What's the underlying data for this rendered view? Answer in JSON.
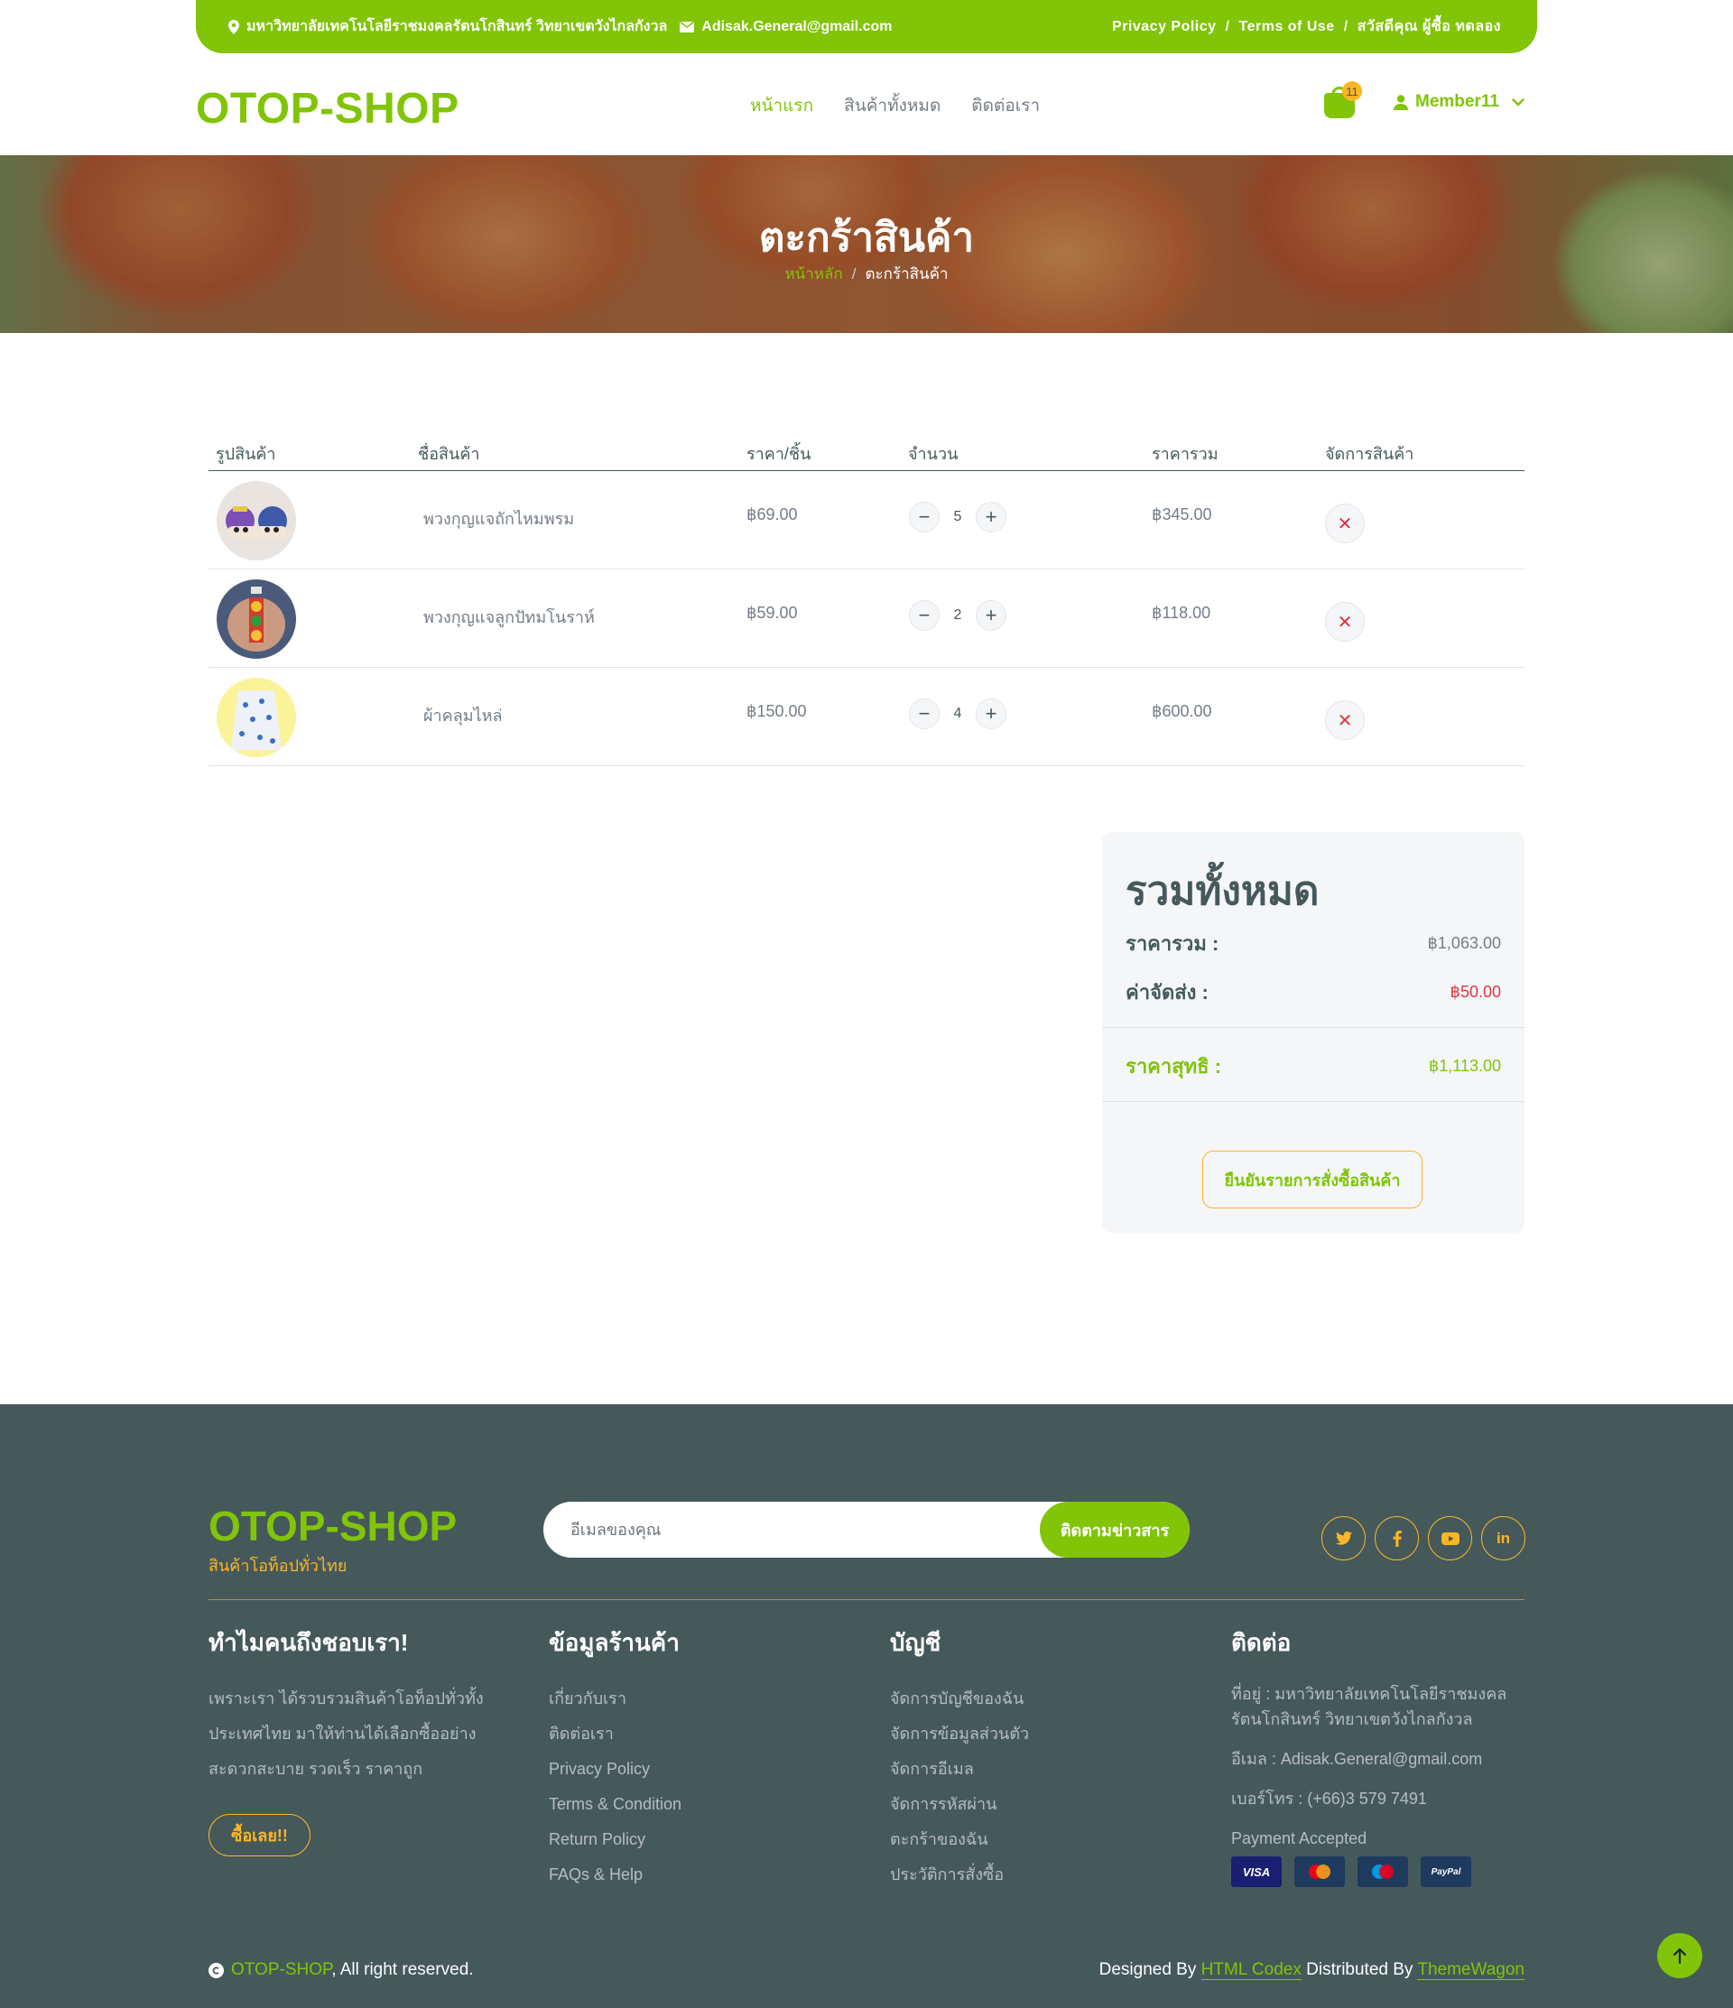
{
  "topbar": {
    "address": "มหาวิทยาลัยเทคโนโลยีราชมงคลรัตนโกสินทร์ วิทยาเขตวังไกลกังวล",
    "email": "Adisak.General@gmail.com",
    "links": [
      "Privacy Policy",
      "Terms of Use",
      "สวัสดีคุณ ผู้ซื้อ ทดลอง"
    ],
    "separator": "/"
  },
  "nav": {
    "logo": "OTOP-SHOP",
    "menu": [
      "หน้าแรก",
      "สินค้าทั้งหมด",
      "ติดต่อเรา"
    ],
    "cart_count": "11",
    "user": "Member11"
  },
  "hero": {
    "title": "ตะกร้าสินค้า",
    "breadcrumb_home": "หน้าหลัก",
    "breadcrumb_current": "ตะกร้าสินค้า"
  },
  "cart": {
    "headers": [
      "รูปสินค้า",
      "ชื่อสินค้า",
      "ราคา/ชิ้น",
      "จำนวน",
      "ราคารวม",
      "จัดการสินค้า"
    ],
    "items": [
      {
        "name": "พวงกุญแจถักไหมพรม",
        "price": "฿69.00",
        "qty": "5",
        "total": "฿345.00"
      },
      {
        "name": "พวงกุญแจลูกปัทมโนราห์",
        "price": "฿59.00",
        "qty": "2",
        "total": "฿118.00"
      },
      {
        "name": "ผ้าคลุมไหล่",
        "price": "฿150.00",
        "qty": "4",
        "total": "฿600.00"
      }
    ]
  },
  "summary": {
    "title": "รวมทั้งหมด",
    "subtotal_label": "ราคารวม :",
    "subtotal": "฿1,063.00",
    "shipping_label": "ค่าจัดส่ง :",
    "shipping": "฿50.00",
    "net_label": "ราคาสุทธิ :",
    "net": "฿1,113.00",
    "confirm": "ยืนยันรายการสั่งซื้อสินค้า"
  },
  "footer": {
    "logo": "OTOP-SHOP",
    "tagline": "สินค้าโอท็อปทั่วไทย",
    "email_placeholder": "อีเมลของคุณ",
    "subscribe": "ติดตามข่าวสาร",
    "socials": [
      "twitter",
      "facebook",
      "youtube",
      "linkedin"
    ],
    "why": {
      "title": "ทำไมคนถึงชอบเรา!",
      "text": "เพราะเรา ได้รวบรวมสินค้าโอท็อปทั่วทั้งประเทศไทย มาให้ท่านได้เลือกซื้ออย่างสะดวกสะบาย รวดเร็ว ราคาถูก",
      "button": "ซื้อเลย!!"
    },
    "shop": {
      "title": "ข้อมูลร้านค้า",
      "links": [
        "เกี่ยวกับเรา",
        "ติดต่อเรา",
        "Privacy Policy",
        "Terms & Condition",
        "Return Policy",
        "FAQs & Help"
      ]
    },
    "account": {
      "title": "บัญชี",
      "links": [
        "จัดการบัญชีของฉัน",
        "จัดการข้อมูลส่วนตัว",
        "จัดการอีเมล",
        "จัดการรหัสผ่าน",
        "ตะกร้าของฉัน",
        "ประวัติการสั่งซื้อ"
      ]
    },
    "contact": {
      "title": "ติดต่อ",
      "address": "ที่อยู่ : มหาวิทยาลัยเทคโนโลยีราชมงคลรัตนโกสินทร์ วิทยาเขตวังไกลกังวล",
      "email": "อีเมล : Adisak.General@gmail.com",
      "phone": "เบอร์โทร : (+66)3 579 7491",
      "payment": "Payment Accepted",
      "cards": [
        "VISA",
        "MasterCard",
        "Maestro",
        "PayPal"
      ]
    },
    "copyright_brand": "OTOP-SHOP",
    "copyright_rest": ", All right reserved.",
    "designed_by": "Designed By",
    "designer": "HTML Codex",
    "distributed_by": "Distributed By",
    "distributor": "ThemeWagon"
  },
  "colors": {
    "primary": "#81c408",
    "secondary": "#ffb524",
    "dark": "#45595b",
    "danger": "#dc3545"
  }
}
